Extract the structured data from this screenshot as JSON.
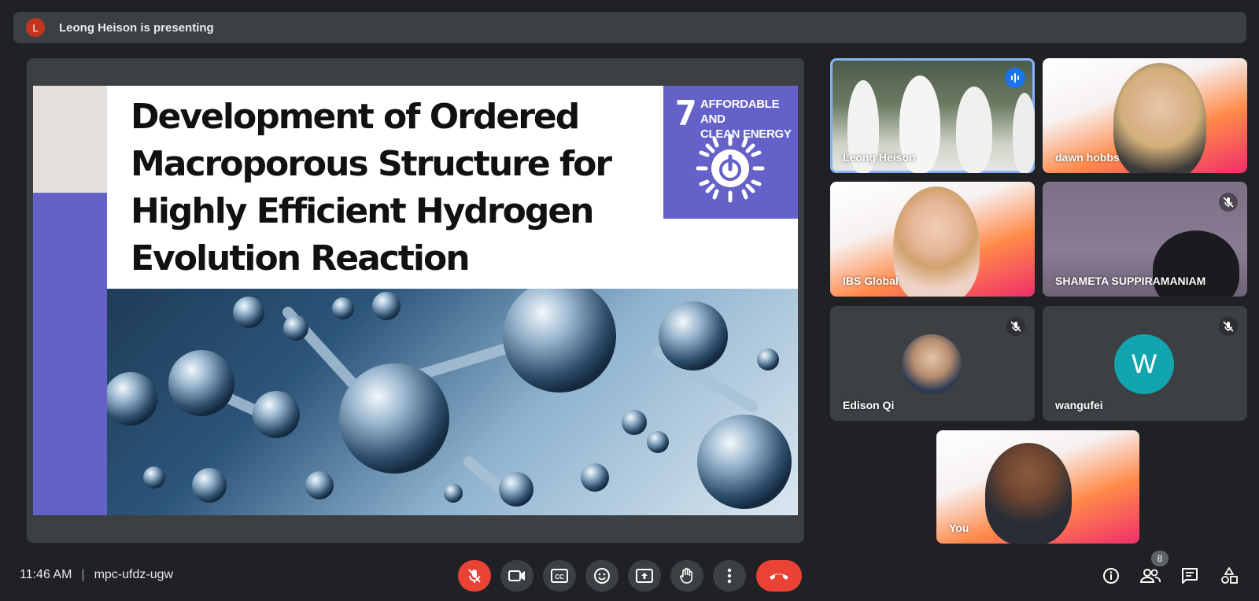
{
  "banner": {
    "avatar_letter": "L",
    "text": "Leong Heison is presenting"
  },
  "slide": {
    "title_lines": [
      "Development of Ordered",
      "Macroporous Structure for",
      "Highly Efficient Hydrogen",
      "Evolution Reaction"
    ],
    "sdg_number": "7",
    "sdg_label_lines": [
      "AFFORDABLE AND",
      "CLEAN ENERGY"
    ]
  },
  "participants": [
    {
      "name": "Leong Heison",
      "state": "speaking"
    },
    {
      "name": "dawn hobbs",
      "state": "unmuted"
    },
    {
      "name": "IBS Global",
      "state": "unmuted"
    },
    {
      "name": "SHAMETA SUPPIRAMANIAM",
      "state": "muted"
    },
    {
      "name": "Edison Qi",
      "state": "muted"
    },
    {
      "name": "wangufei",
      "state": "muted",
      "avatar_letter": "W",
      "avatar_color": "#12a4af"
    },
    {
      "name": "You",
      "state": "self"
    }
  ],
  "bottom": {
    "time": "11:46 AM",
    "separator": "|",
    "meeting_code": "mpc-ufdz-ugw",
    "people_count": "8"
  },
  "colors": {
    "accent_red": "#ea4335",
    "speaking_blue": "#1a73e8",
    "sdg_purple": "#6461c8"
  }
}
